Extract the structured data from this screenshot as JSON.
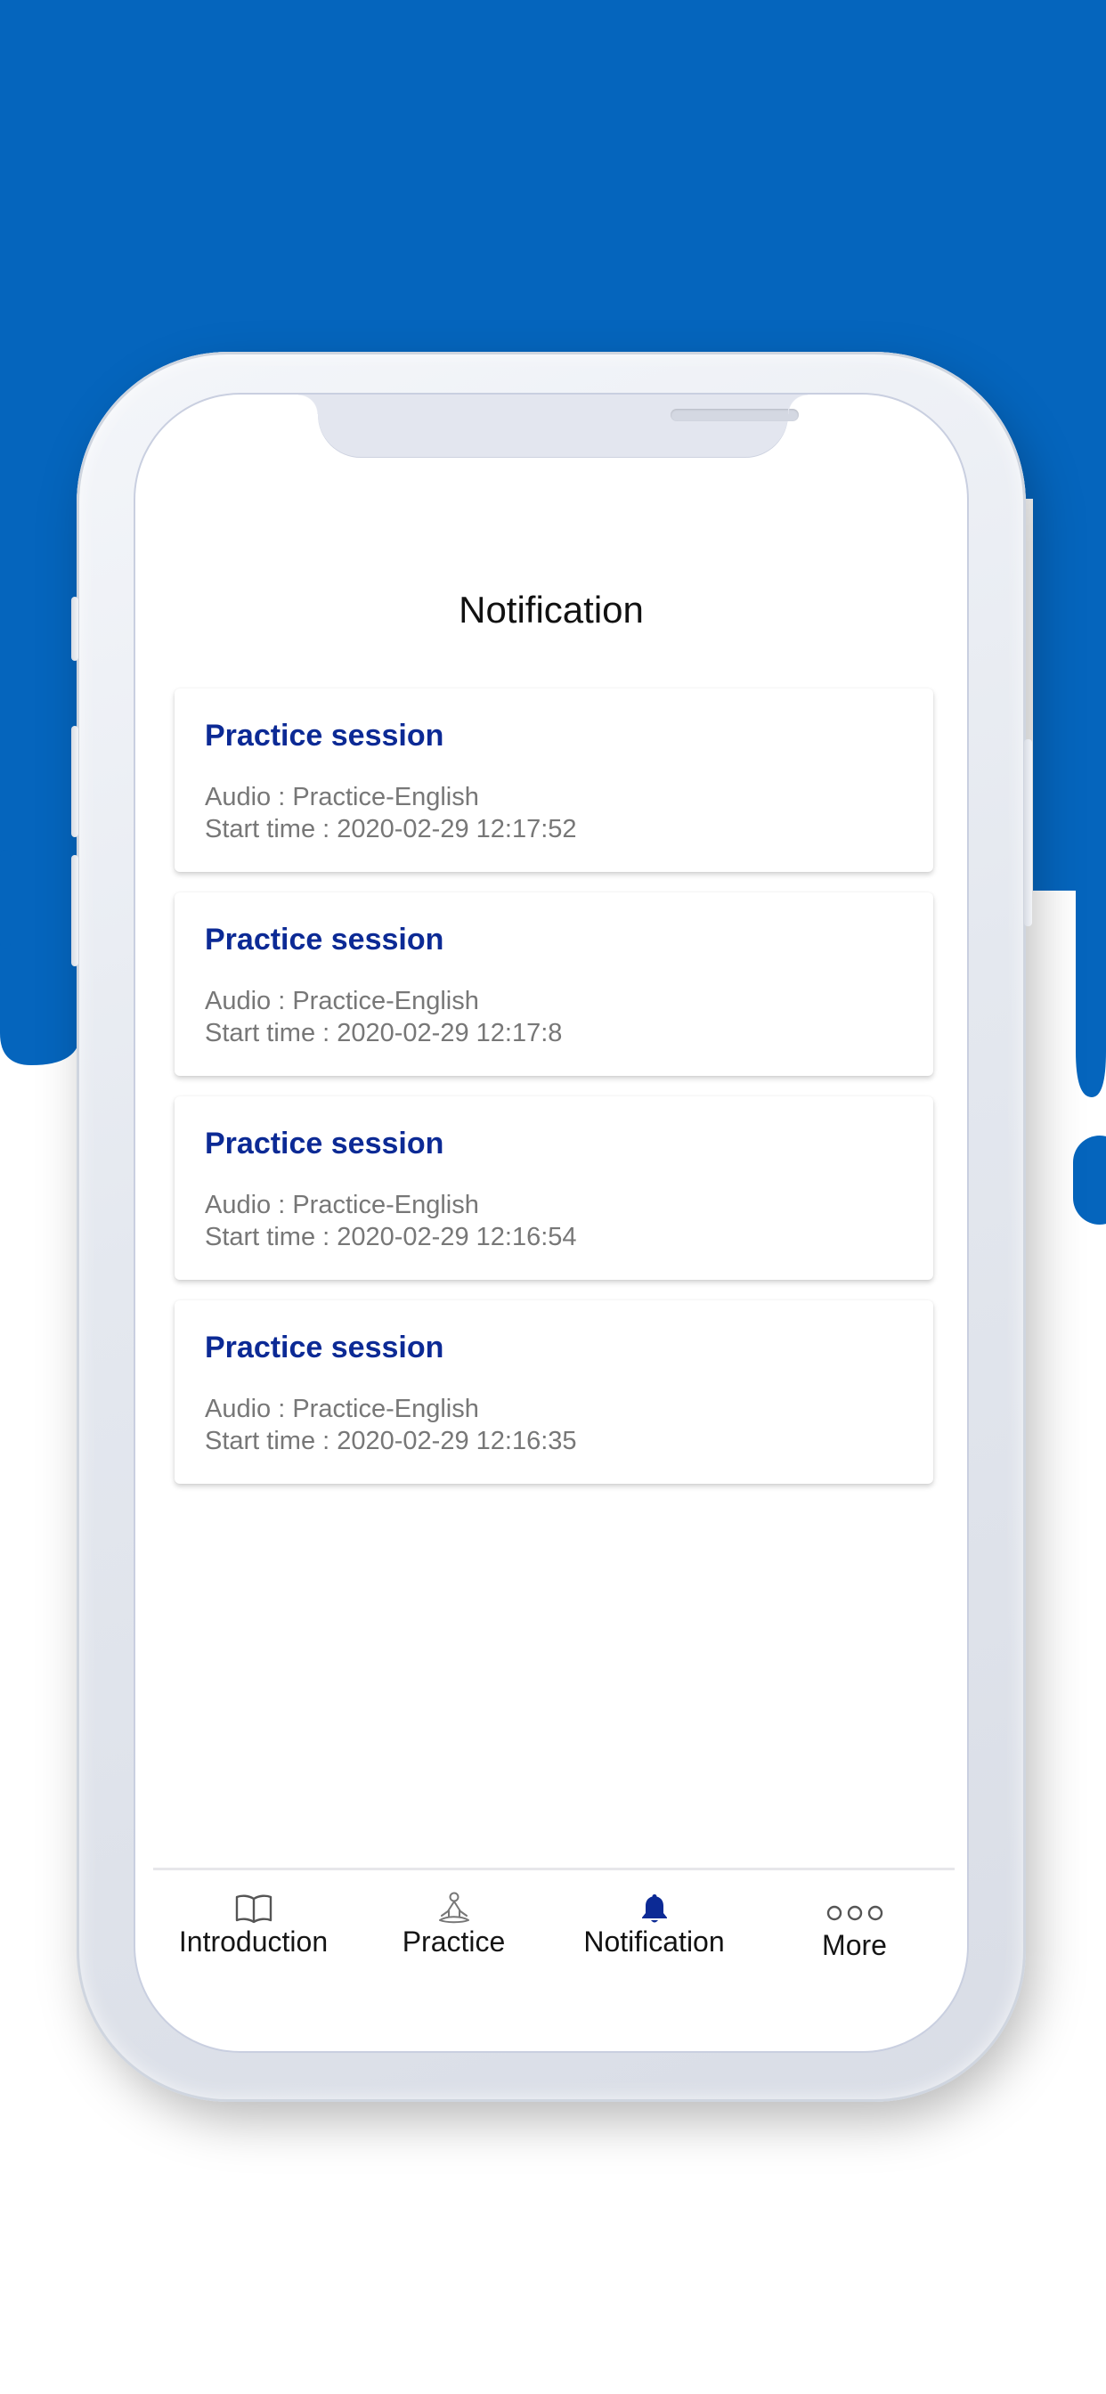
{
  "page": {
    "title": "Notification"
  },
  "notifications": [
    {
      "title": "Practice session",
      "audio": "Audio : Practice-English",
      "start": "Start time : 2020-02-29 12:17:52"
    },
    {
      "title": "Practice session",
      "audio": "Audio : Practice-English",
      "start": "Start time : 2020-02-29 12:17:8"
    },
    {
      "title": "Practice session",
      "audio": "Audio : Practice-English",
      "start": "Start time : 2020-02-29 12:16:54"
    },
    {
      "title": "Practice session",
      "audio": "Audio : Practice-English",
      "start": "Start time : 2020-02-29 12:16:35"
    }
  ],
  "tabs": [
    {
      "label": "Introduction",
      "icon": "book-icon",
      "active": false
    },
    {
      "label": "Practice",
      "icon": "meditation-icon",
      "active": false
    },
    {
      "label": "Notification",
      "icon": "bell-icon",
      "active": true
    },
    {
      "label": "More",
      "icon": "more-dots-icon",
      "active": false
    }
  ],
  "colors": {
    "background_blue": "#0565bd",
    "accent": "#0c2a95",
    "secondary_text": "#777777"
  }
}
